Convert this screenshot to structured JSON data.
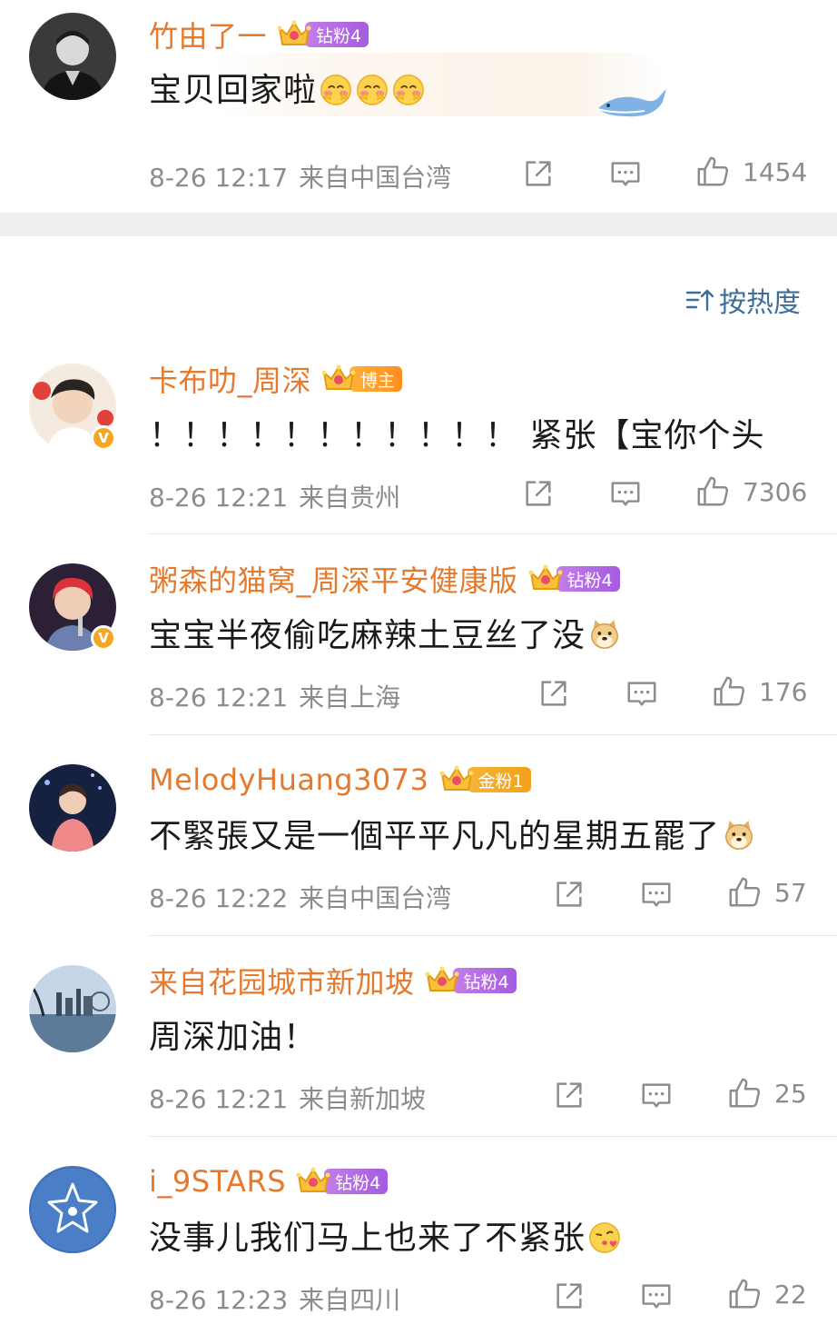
{
  "sort_label": "按热度",
  "comments": [
    {
      "username": "竹由了一",
      "badge": "钻粉4",
      "badge_type": "diamond",
      "text": "宝贝回家啦",
      "emoji": [
        "bashful-emoji",
        "bashful-emoji",
        "bashful-emoji"
      ],
      "time": "8-26 12:17",
      "location": "来自中国台湾",
      "likes": "1454",
      "verified": false
    },
    {
      "username": "卡布叻_周深",
      "badge": "博主",
      "badge_type": "blogger",
      "text": "！！！！！！！！！！！ 紧张【宝你个头",
      "emoji": [],
      "time": "8-26 12:21",
      "location": "来自贵州",
      "likes": "7306",
      "verified": true
    },
    {
      "username": "粥森的猫窝_周深平安健康版",
      "badge": "钻粉4",
      "badge_type": "diamond",
      "text": "宝宝半夜偷吃麻辣土豆丝了没",
      "emoji": [
        "doge-emoji"
      ],
      "time": "8-26 12:21",
      "location": "来自上海",
      "likes": "176",
      "verified": true
    },
    {
      "username": "MelodyHuang3073",
      "badge": "金粉1",
      "badge_type": "gold",
      "text": "不緊張又是一個平平凡凡的星期五罷了",
      "emoji": [
        "doge-emoji"
      ],
      "time": "8-26 12:22",
      "location": "来自中国台湾",
      "likes": "57",
      "verified": false
    },
    {
      "username": "来自花园城市新加坡",
      "badge": "钻粉4",
      "badge_type": "diamond",
      "text": "周深加油！",
      "emoji": [],
      "time": "8-26 12:21",
      "location": "来自新加坡",
      "likes": "25",
      "verified": false
    },
    {
      "username": "i_9STARS",
      "badge": "钻粉4",
      "badge_type": "diamond",
      "text": "没事儿我们马上也来了不紧张",
      "emoji": [
        "kiss-emoji"
      ],
      "time": "8-26 12:23",
      "location": "来自四川",
      "likes": "22",
      "verified": false
    }
  ],
  "colors": {
    "username": "#e5792e",
    "meta": "#8c8c8c",
    "sort": "#3e6d9a",
    "diamond_badge": "#b06be4",
    "gold_badge": "#f2a722"
  }
}
